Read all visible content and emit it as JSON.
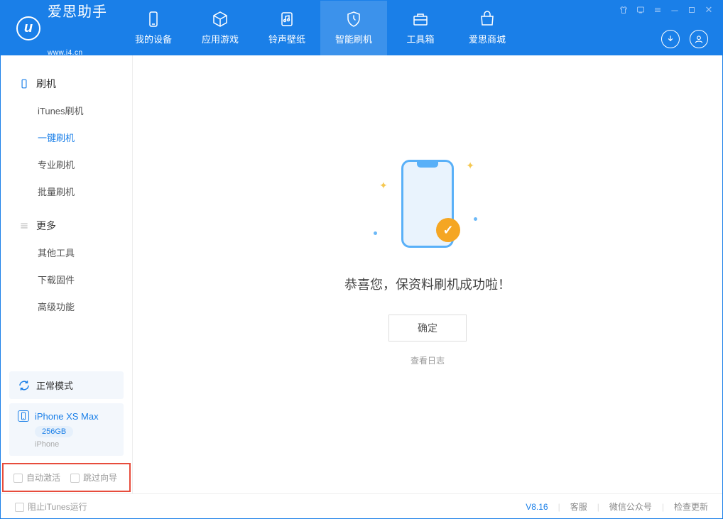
{
  "logo": {
    "title": "爱思助手",
    "subtitle": "www.i4.cn"
  },
  "nav": {
    "items": [
      {
        "label": "我的设备"
      },
      {
        "label": "应用游戏"
      },
      {
        "label": "铃声壁纸"
      },
      {
        "label": "智能刷机"
      },
      {
        "label": "工具箱"
      },
      {
        "label": "爱思商城"
      }
    ]
  },
  "sidebar": {
    "section1": "刷机",
    "items1": [
      "iTunes刷机",
      "一键刷机",
      "专业刷机",
      "批量刷机"
    ],
    "section2": "更多",
    "items2": [
      "其他工具",
      "下载固件",
      "高级功能"
    ],
    "mode": "正常模式",
    "device_name": "iPhone XS Max",
    "storage": "256GB",
    "device_type": "iPhone",
    "auto_activate": "自动激活",
    "skip_wizard": "跳过向导"
  },
  "main": {
    "success": "恭喜您，保资料刷机成功啦！",
    "ok": "确定",
    "log": "查看日志"
  },
  "footer": {
    "block_itunes": "阻止iTunes运行",
    "version": "V8.16",
    "support": "客服",
    "wechat": "微信公众号",
    "update": "检查更新"
  }
}
